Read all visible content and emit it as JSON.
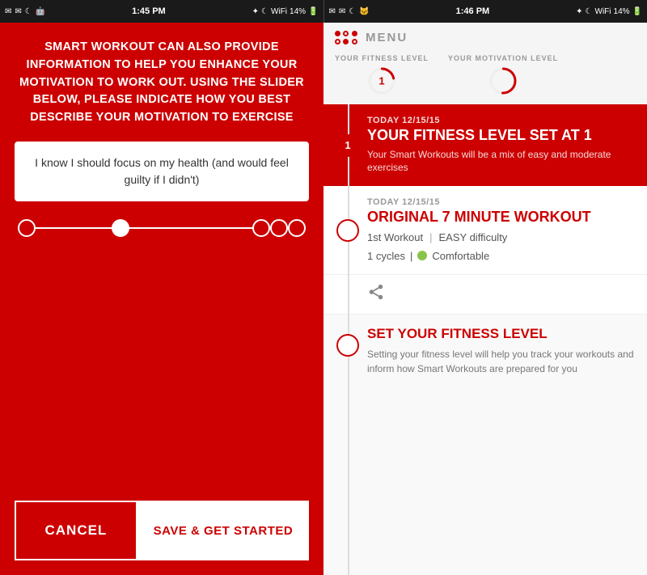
{
  "statusBars": {
    "left": {
      "time": "1:45 PM",
      "battery": "14%"
    },
    "right": {
      "time": "1:46 PM",
      "battery": "14%"
    }
  },
  "leftPanel": {
    "motivationText": "SMART WORKOUT CAN ALSO PROVIDE INFORMATION TO HELP YOU ENHANCE YOUR MOTIVATION TO WORK OUT. USING THE SLIDER BELOW, PLEASE INDICATE HOW YOU BEST DESCRIBE YOUR MOTIVATION TO EXERCISE",
    "motivationBox": "I know I should focus on my health (and would feel guilty if I didn't)",
    "cancelButton": "CANCEL",
    "saveButton": "SAVE & GET STARTED"
  },
  "rightPanel": {
    "menuTitle": "MENU",
    "fitnessLevelLabel": "YOUR FITNESS LEVEL",
    "motivationLevelLabel": "YOUR MOTIVATION LEVEL",
    "fitnessValue": "1",
    "timeline": [
      {
        "date": "TODAY 12/15/15",
        "title": "YOUR FITNESS LEVEL SET AT 1",
        "subtitle": "Your Smart Workouts will be a mix of easy and moderate exercises",
        "type": "red"
      },
      {
        "date": "TODAY 12/15/15",
        "title": "ORIGINAL 7 MINUTE WORKOUT",
        "subtitle1": "1st Workout",
        "difficulty": "EASY difficulty",
        "cycles": "1 cycles",
        "comfort": "Comfortable",
        "type": "white"
      }
    ],
    "setFitness": {
      "title": "SET YOUR FITNESS LEVEL",
      "text": "Setting your fitness level will help you track your workouts and inform how Smart Workouts are prepared for you"
    }
  }
}
